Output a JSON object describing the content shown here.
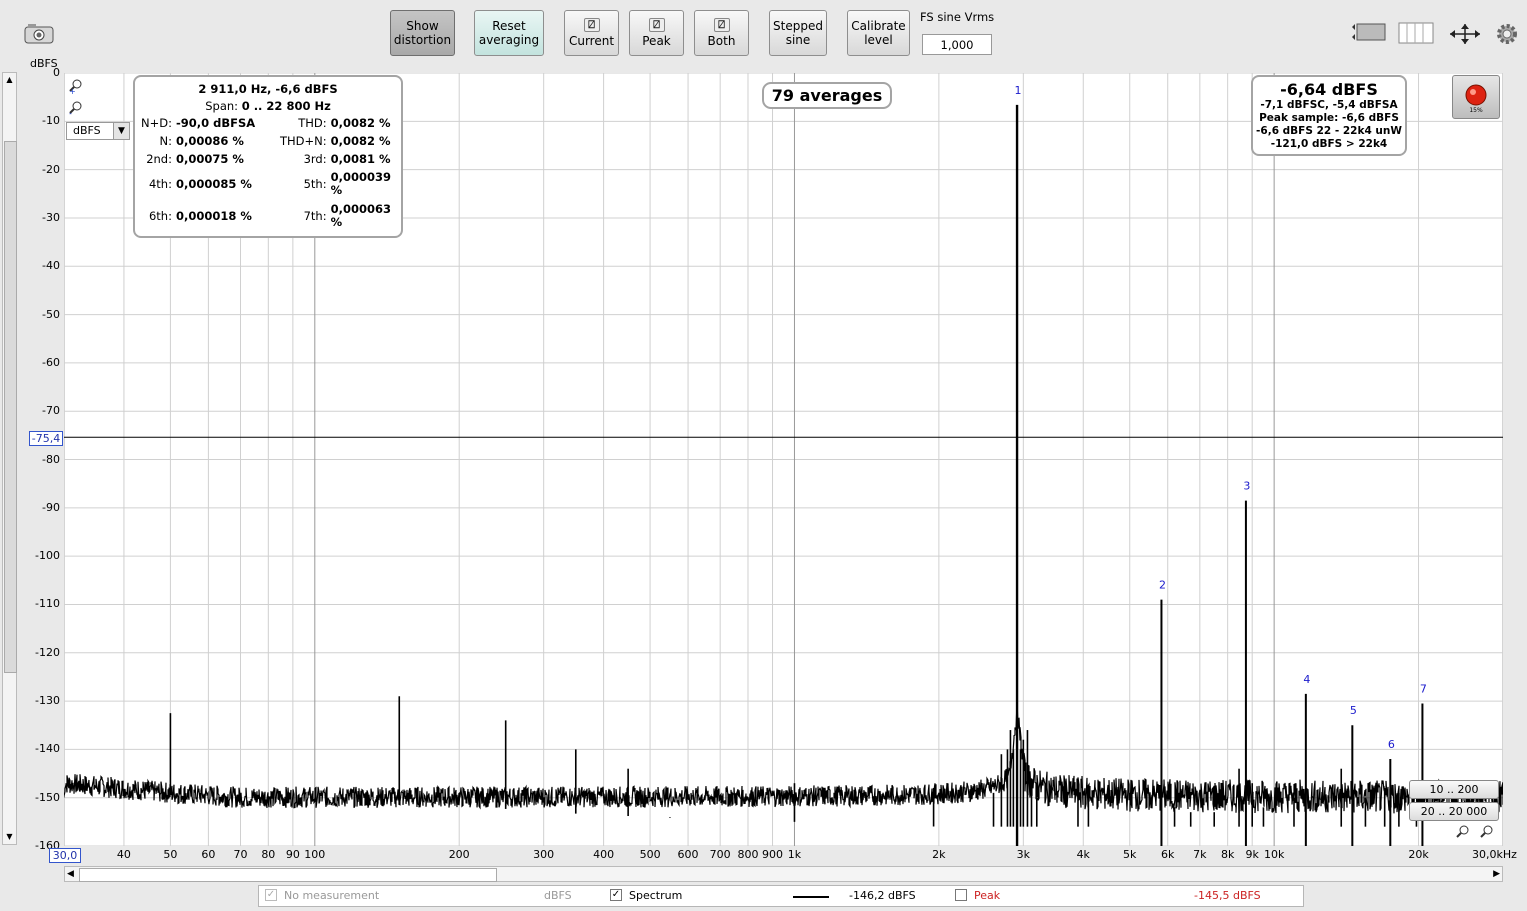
{
  "toolbar": {
    "show_distortion": "Show\ndistortion",
    "reset_averaging": "Reset\naveraging",
    "current": "Current",
    "peak": "Peak",
    "both": "Both",
    "stepped_sine": "Stepped\nsine",
    "calibrate_level": "Calibrate\nlevel",
    "fs_label": "FS sine Vrms",
    "fs_value": "1,000"
  },
  "plot": {
    "y_unit": "dBFS",
    "unit_select": "dBFS",
    "cursor_level": "-75,4",
    "averages": "79 averages",
    "x_start": "30,0",
    "x_end": "30,0kHz",
    "record_pct": "15%"
  },
  "measurement": {
    "header": "2 911,0 Hz, -6,6 dBFS",
    "span_label": "Span:",
    "span_value": "0 .. 22 800 Hz",
    "rows": [
      {
        "k1": "N+D:",
        "v1": "-90,0 dBFSA",
        "k2": "THD:",
        "v2": "0,0082 %"
      },
      {
        "k1": "N:",
        "v1": "0,00086 %",
        "k2": "THD+N:",
        "v2": "0,0082 %"
      },
      {
        "k1": "2nd:",
        "v1": "0,00075 %",
        "k2": "3rd:",
        "v2": "0,0081 %"
      },
      {
        "k1": "4th:",
        "v1": "0,000085 %",
        "k2": "5th:",
        "v2": "0,000039\n%"
      },
      {
        "k1": "6th:",
        "v1": "0,000018 %",
        "k2": "7th:",
        "v2": "0,000063\n%"
      }
    ]
  },
  "level": {
    "main": "-6,64 dBFS",
    "line1": "-7,1 dBFSC, -5,4 dBFSA",
    "line2": "Peak sample: -6,6 dBFS",
    "line3": "-6,6 dBFS 22 - 22k4 unW",
    "line4": "-121,0 dBFS > 22k4"
  },
  "range_buttons": [
    "10 .. 200",
    "20 .. 20 000"
  ],
  "legend": {
    "no_measurement": "No measurement",
    "no_measurement_unit": "dBFS",
    "spectrum": "Spectrum",
    "spectrum_value": "-146,2 dBFS",
    "peak": "Peak",
    "peak_value": "-145,5 dBFS"
  },
  "colors": {
    "plot_bg": "#ffffff",
    "trace": "#000000",
    "harmonic_label": "#1a1acc",
    "peak_text": "#cc2222"
  },
  "chart_data": {
    "type": "line",
    "xscale": "log",
    "xlim": [
      30,
      30000
    ],
    "ylim": [
      -160,
      0
    ],
    "ylabel": "dBFS",
    "grid": true,
    "x_tick_labels": [
      "40",
      "50",
      "60",
      "70",
      "80",
      "90",
      "100",
      "200",
      "300",
      "400",
      "500",
      "600",
      "700",
      "800",
      "900",
      "1k",
      "2k",
      "3k",
      "4k",
      "5k",
      "6k",
      "7k",
      "8k",
      "9k",
      "10k",
      "20k"
    ],
    "x_tick_values": [
      40,
      50,
      60,
      70,
      80,
      90,
      100,
      200,
      300,
      400,
      500,
      600,
      700,
      800,
      900,
      1000,
      2000,
      3000,
      4000,
      5000,
      6000,
      7000,
      8000,
      9000,
      10000,
      20000
    ],
    "y_ticks": [
      0,
      -10,
      -20,
      -30,
      -40,
      -50,
      -60,
      -70,
      -80,
      -90,
      -100,
      -110,
      -120,
      -130,
      -140,
      -150,
      -160
    ],
    "noise_floor": {
      "x": [
        30,
        50,
        100,
        200,
        300,
        500,
        1000,
        2000,
        2600
      ],
      "y": [
        -147,
        -149,
        -151,
        -152.5,
        -154,
        -155,
        -156,
        -157,
        -157
      ]
    },
    "harmonics": [
      {
        "label": "1",
        "freq": 2911,
        "level": -6.6
      },
      {
        "label": "2",
        "freq": 5822,
        "level": -109
      },
      {
        "label": "3",
        "freq": 8733,
        "level": -88.5
      },
      {
        "label": "4",
        "freq": 11644,
        "level": -128.5
      },
      {
        "label": "5",
        "freq": 14555,
        "level": -135
      },
      {
        "label": "6",
        "freq": 17466,
        "level": -142
      },
      {
        "label": "7",
        "freq": 20377,
        "level": -130.5
      }
    ],
    "spurs": [
      {
        "freq": 50,
        "level": -132.5
      },
      {
        "freq": 150,
        "level": -129
      },
      {
        "freq": 250,
        "level": -134
      },
      {
        "freq": 350,
        "level": -140
      },
      {
        "freq": 450,
        "level": -144
      },
      {
        "freq": 550,
        "level": -154
      },
      {
        "freq": 1000,
        "level": -147
      },
      {
        "freq": 1950,
        "level": -148
      },
      {
        "freq": 2600,
        "level": -149
      },
      {
        "freq": 2700,
        "level": -141
      },
      {
        "freq": 2780,
        "level": -140
      },
      {
        "freq": 2820,
        "level": -136
      },
      {
        "freq": 2860,
        "level": -140
      },
      {
        "freq": 2960,
        "level": -140
      },
      {
        "freq": 3000,
        "level": -138
      },
      {
        "freq": 3060,
        "level": -136
      },
      {
        "freq": 3120,
        "level": -146
      },
      {
        "freq": 3200,
        "level": -150
      },
      {
        "freq": 3900,
        "level": -147
      },
      {
        "freq": 4100,
        "level": -150
      },
      {
        "freq": 6200,
        "level": -152
      },
      {
        "freq": 6700,
        "level": -153
      },
      {
        "freq": 7500,
        "level": -153
      },
      {
        "freq": 8450,
        "level": -144
      },
      {
        "freq": 9000,
        "level": -147
      },
      {
        "freq": 9500,
        "level": -152
      },
      {
        "freq": 11000,
        "level": -150
      },
      {
        "freq": 13800,
        "level": -144
      },
      {
        "freq": 15500,
        "level": -150
      },
      {
        "freq": 17000,
        "level": -148
      },
      {
        "freq": 18200,
        "level": -149
      },
      {
        "freq": 19800,
        "level": -151
      }
    ]
  }
}
